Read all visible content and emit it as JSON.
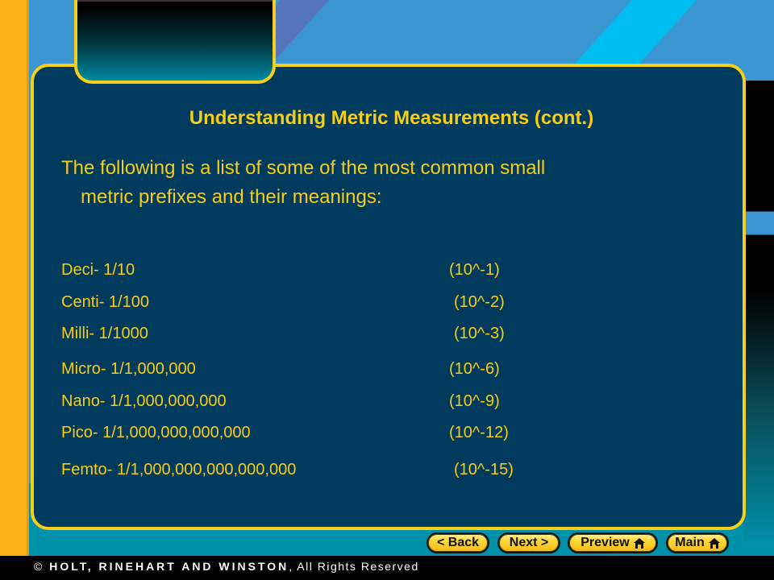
{
  "slide": {
    "title": "Understanding Metric Measurements (cont.)",
    "intro_line1": "The following is a list of some of the most common small",
    "intro_line2": "metric prefixes and their meanings:",
    "prefixes": [
      {
        "name": "Deci- 1/10",
        "power": "(10^-1)"
      },
      {
        "name": "Centi- 1/100",
        "power": "(10^-2)"
      },
      {
        "name": "Milli- 1/1000",
        "power": "(10^-3)"
      },
      {
        "name": "Micro- 1/1,000,000",
        "power": "(10^-6)"
      },
      {
        "name": "Nano- 1/1,000,000,000",
        "power": "(10^-9)"
      },
      {
        "name": "Pico- 1/1,000,000,000,000",
        "power": "(10^-12)"
      },
      {
        "name": "Femto- 1/1,000,000,000,000,000",
        "power": "(10^-15)"
      }
    ]
  },
  "nav": {
    "back_label": "< Back",
    "next_label": "Next >",
    "preview_label": "Preview",
    "main_label": "Main",
    "home_icon": "home-icon"
  },
  "footer": {
    "copyright_symbol": "©",
    "publisher": "HOLT, RINEHART AND WINSTON",
    "rights": ", All Rights Reserved"
  },
  "colors": {
    "panel_bg": "#003a5c",
    "text_accent": "#f7cd17",
    "border_accent": "#f4cf1e",
    "sidebar": "#fbb217"
  }
}
